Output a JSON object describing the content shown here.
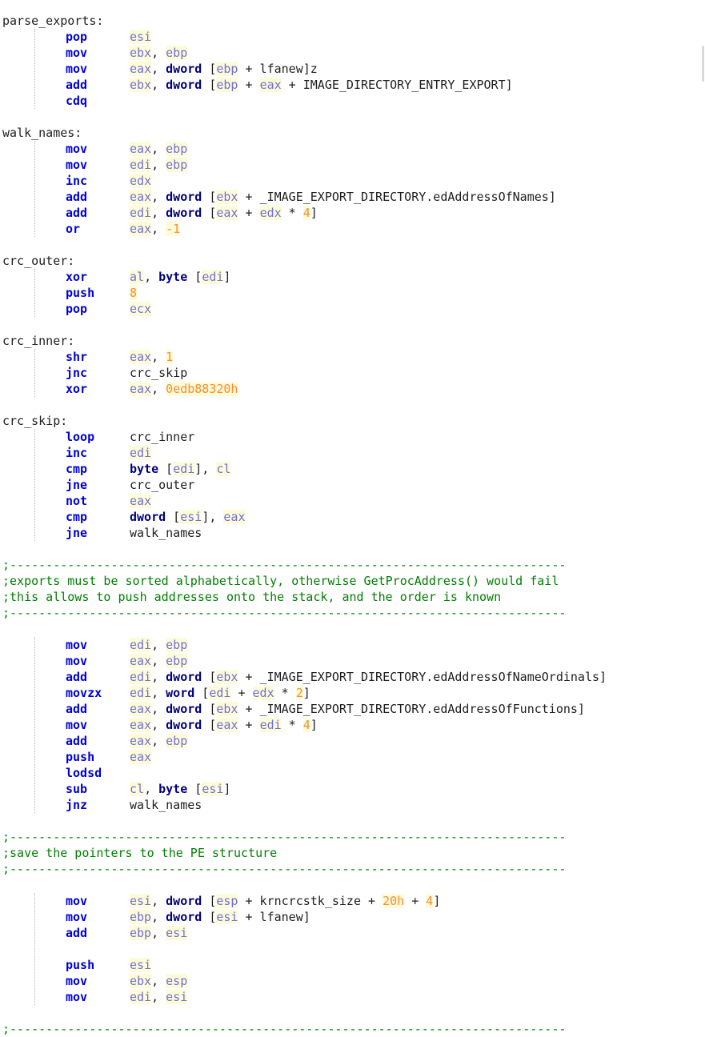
{
  "lines": [
    [
      {
        "t": "parse_exports:",
        "c": "lbl"
      }
    ],
    [
      {
        "t": "pop",
        "c": "ins"
      },
      {
        "t": "esi",
        "c": "reg"
      }
    ],
    [
      {
        "t": "mov",
        "c": "ins"
      },
      {
        "t": "ebx",
        "c": "reg"
      },
      {
        "t": ", ",
        "c": "plain"
      },
      {
        "t": "ebp",
        "c": "reg"
      }
    ],
    [
      {
        "t": "mov",
        "c": "ins"
      },
      {
        "t": "eax",
        "c": "reg"
      },
      {
        "t": ", ",
        "c": "plain"
      },
      {
        "t": "dword",
        "c": "kw"
      },
      {
        "t": " [",
        "c": "plain"
      },
      {
        "t": "ebp",
        "c": "reg"
      },
      {
        "t": " + lfanew]z",
        "c": "plain"
      }
    ],
    [
      {
        "t": "add",
        "c": "ins"
      },
      {
        "t": "ebx",
        "c": "reg"
      },
      {
        "t": ", ",
        "c": "plain"
      },
      {
        "t": "dword",
        "c": "kw"
      },
      {
        "t": " [",
        "c": "plain"
      },
      {
        "t": "ebp",
        "c": "reg"
      },
      {
        "t": " + ",
        "c": "plain"
      },
      {
        "t": "eax",
        "c": "reg"
      },
      {
        "t": " + IMAGE_DIRECTORY_ENTRY_EXPORT]",
        "c": "plain"
      }
    ],
    [
      {
        "t": "cdq",
        "c": "ins"
      }
    ],
    [],
    [
      {
        "t": "walk_names:",
        "c": "lbl"
      }
    ],
    [
      {
        "t": "mov",
        "c": "ins"
      },
      {
        "t": "eax",
        "c": "reg"
      },
      {
        "t": ", ",
        "c": "plain"
      },
      {
        "t": "ebp",
        "c": "reg"
      }
    ],
    [
      {
        "t": "mov",
        "c": "ins"
      },
      {
        "t": "edi",
        "c": "reg"
      },
      {
        "t": ", ",
        "c": "plain"
      },
      {
        "t": "ebp",
        "c": "reg"
      }
    ],
    [
      {
        "t": "inc",
        "c": "ins"
      },
      {
        "t": "edx",
        "c": "reg"
      }
    ],
    [
      {
        "t": "add",
        "c": "ins"
      },
      {
        "t": "eax",
        "c": "reg"
      },
      {
        "t": ", ",
        "c": "plain"
      },
      {
        "t": "dword",
        "c": "kw"
      },
      {
        "t": " [",
        "c": "plain"
      },
      {
        "t": "ebx",
        "c": "reg"
      },
      {
        "t": " + _IMAGE_EXPORT_DIRECTORY.edAddressOfNames]",
        "c": "plain"
      }
    ],
    [
      {
        "t": "add",
        "c": "ins"
      },
      {
        "t": "edi",
        "c": "reg"
      },
      {
        "t": ", ",
        "c": "plain"
      },
      {
        "t": "dword",
        "c": "kw"
      },
      {
        "t": " [",
        "c": "plain"
      },
      {
        "t": "eax",
        "c": "reg"
      },
      {
        "t": " + ",
        "c": "plain"
      },
      {
        "t": "edx",
        "c": "reg"
      },
      {
        "t": " * ",
        "c": "plain"
      },
      {
        "t": "4",
        "c": "num"
      },
      {
        "t": "]",
        "c": "plain"
      }
    ],
    [
      {
        "t": "or",
        "c": "ins"
      },
      {
        "t": "eax",
        "c": "reg"
      },
      {
        "t": ", ",
        "c": "plain"
      },
      {
        "t": "-1",
        "c": "num"
      }
    ],
    [],
    [
      {
        "t": "crc_outer:",
        "c": "lbl"
      }
    ],
    [
      {
        "t": "xor",
        "c": "ins"
      },
      {
        "t": "al",
        "c": "reg"
      },
      {
        "t": ", ",
        "c": "plain"
      },
      {
        "t": "byte",
        "c": "kw"
      },
      {
        "t": " [",
        "c": "plain"
      },
      {
        "t": "edi",
        "c": "reg"
      },
      {
        "t": "]",
        "c": "plain"
      }
    ],
    [
      {
        "t": "push",
        "c": "ins"
      },
      {
        "t": "8",
        "c": "num"
      }
    ],
    [
      {
        "t": "pop",
        "c": "ins"
      },
      {
        "t": "ecx",
        "c": "reg"
      }
    ],
    [],
    [
      {
        "t": "crc_inner:",
        "c": "lbl"
      }
    ],
    [
      {
        "t": "shr",
        "c": "ins"
      },
      {
        "t": "eax",
        "c": "reg"
      },
      {
        "t": ", ",
        "c": "plain"
      },
      {
        "t": "1",
        "c": "num"
      }
    ],
    [
      {
        "t": "jnc",
        "c": "ins"
      },
      {
        "t": "crc_skip",
        "c": "plain"
      }
    ],
    [
      {
        "t": "xor",
        "c": "ins"
      },
      {
        "t": "eax",
        "c": "reg"
      },
      {
        "t": ", ",
        "c": "plain"
      },
      {
        "t": "0edb88320h",
        "c": "num"
      }
    ],
    [],
    [
      {
        "t": "crc_skip:",
        "c": "lbl"
      }
    ],
    [
      {
        "t": "loop",
        "c": "ins"
      },
      {
        "t": "crc_inner",
        "c": "plain"
      }
    ],
    [
      {
        "t": "inc",
        "c": "ins"
      },
      {
        "t": "edi",
        "c": "reg"
      }
    ],
    [
      {
        "t": "cmp",
        "c": "ins"
      },
      {
        "t": "byte",
        "c": "kw"
      },
      {
        "t": " [",
        "c": "plain"
      },
      {
        "t": "edi",
        "c": "reg"
      },
      {
        "t": "], ",
        "c": "plain"
      },
      {
        "t": "cl",
        "c": "reg"
      }
    ],
    [
      {
        "t": "jne",
        "c": "ins"
      },
      {
        "t": "crc_outer",
        "c": "plain"
      }
    ],
    [
      {
        "t": "not",
        "c": "ins"
      },
      {
        "t": "eax",
        "c": "reg"
      }
    ],
    [
      {
        "t": "cmp",
        "c": "ins"
      },
      {
        "t": "dword",
        "c": "kw"
      },
      {
        "t": " [",
        "c": "plain"
      },
      {
        "t": "esi",
        "c": "reg"
      },
      {
        "t": "], ",
        "c": "plain"
      },
      {
        "t": "eax",
        "c": "reg"
      }
    ],
    [
      {
        "t": "jne",
        "c": "ins"
      },
      {
        "t": "walk_names",
        "c": "plain"
      }
    ],
    [],
    [
      {
        "t": ";-----------------------------------------------------------------------------",
        "c": "cmt"
      }
    ],
    [
      {
        "t": ";exports must be sorted alphabetically, otherwise GetProcAddress() would fail",
        "c": "cmt"
      }
    ],
    [
      {
        "t": ";this allows to push addresses onto the stack, and the order is known",
        "c": "cmt"
      }
    ],
    [
      {
        "t": ";-----------------------------------------------------------------------------",
        "c": "cmt"
      }
    ],
    [],
    [
      {
        "t": "mov",
        "c": "ins"
      },
      {
        "t": "edi",
        "c": "reg"
      },
      {
        "t": ", ",
        "c": "plain"
      },
      {
        "t": "ebp",
        "c": "reg"
      }
    ],
    [
      {
        "t": "mov",
        "c": "ins"
      },
      {
        "t": "eax",
        "c": "reg"
      },
      {
        "t": ", ",
        "c": "plain"
      },
      {
        "t": "ebp",
        "c": "reg"
      }
    ],
    [
      {
        "t": "add",
        "c": "ins"
      },
      {
        "t": "edi",
        "c": "reg"
      },
      {
        "t": ", ",
        "c": "plain"
      },
      {
        "t": "dword",
        "c": "kw"
      },
      {
        "t": " [",
        "c": "plain"
      },
      {
        "t": "ebx",
        "c": "reg"
      },
      {
        "t": " + _IMAGE_EXPORT_DIRECTORY.edAddressOfNameOrdinals]",
        "c": "plain"
      }
    ],
    [
      {
        "t": "movzx",
        "c": "ins"
      },
      {
        "t": "edi",
        "c": "reg"
      },
      {
        "t": ", ",
        "c": "plain"
      },
      {
        "t": "word",
        "c": "kw"
      },
      {
        "t": " [",
        "c": "plain"
      },
      {
        "t": "edi",
        "c": "reg"
      },
      {
        "t": " + ",
        "c": "plain"
      },
      {
        "t": "edx",
        "c": "reg"
      },
      {
        "t": " * ",
        "c": "plain"
      },
      {
        "t": "2",
        "c": "num"
      },
      {
        "t": "]",
        "c": "plain"
      }
    ],
    [
      {
        "t": "add",
        "c": "ins"
      },
      {
        "t": "eax",
        "c": "reg"
      },
      {
        "t": ", ",
        "c": "plain"
      },
      {
        "t": "dword",
        "c": "kw"
      },
      {
        "t": " [",
        "c": "plain"
      },
      {
        "t": "ebx",
        "c": "reg"
      },
      {
        "t": " + _IMAGE_EXPORT_DIRECTORY.edAddressOfFunctions]",
        "c": "plain"
      }
    ],
    [
      {
        "t": "mov",
        "c": "ins"
      },
      {
        "t": "eax",
        "c": "reg"
      },
      {
        "t": ", ",
        "c": "plain"
      },
      {
        "t": "dword",
        "c": "kw"
      },
      {
        "t": " [",
        "c": "plain"
      },
      {
        "t": "eax",
        "c": "reg"
      },
      {
        "t": " + ",
        "c": "plain"
      },
      {
        "t": "edi",
        "c": "reg"
      },
      {
        "t": " * ",
        "c": "plain"
      },
      {
        "t": "4",
        "c": "num"
      },
      {
        "t": "]",
        "c": "plain"
      }
    ],
    [
      {
        "t": "add",
        "c": "ins"
      },
      {
        "t": "eax",
        "c": "reg"
      },
      {
        "t": ", ",
        "c": "plain"
      },
      {
        "t": "ebp",
        "c": "reg"
      }
    ],
    [
      {
        "t": "push",
        "c": "ins"
      },
      {
        "t": "eax",
        "c": "reg"
      }
    ],
    [
      {
        "t": "lodsd",
        "c": "ins"
      }
    ],
    [
      {
        "t": "sub",
        "c": "ins"
      },
      {
        "t": "cl",
        "c": "reg"
      },
      {
        "t": ", ",
        "c": "plain"
      },
      {
        "t": "byte",
        "c": "kw"
      },
      {
        "t": " [",
        "c": "plain"
      },
      {
        "t": "esi",
        "c": "reg"
      },
      {
        "t": "]",
        "c": "plain"
      }
    ],
    [
      {
        "t": "jnz",
        "c": "ins"
      },
      {
        "t": "walk_names",
        "c": "plain"
      }
    ],
    [],
    [
      {
        "t": ";-----------------------------------------------------------------------------",
        "c": "cmt"
      }
    ],
    [
      {
        "t": ";save the pointers to the PE structure",
        "c": "cmt"
      }
    ],
    [
      {
        "t": ";-----------------------------------------------------------------------------",
        "c": "cmt"
      }
    ],
    [],
    [
      {
        "t": "mov",
        "c": "ins"
      },
      {
        "t": "esi",
        "c": "reg"
      },
      {
        "t": ", ",
        "c": "plain"
      },
      {
        "t": "dword",
        "c": "kw"
      },
      {
        "t": " [",
        "c": "plain"
      },
      {
        "t": "esp",
        "c": "reg"
      },
      {
        "t": " + krncrcstk_size + ",
        "c": "plain"
      },
      {
        "t": "20h",
        "c": "num"
      },
      {
        "t": " + ",
        "c": "plain"
      },
      {
        "t": "4",
        "c": "num"
      },
      {
        "t": "]",
        "c": "plain"
      }
    ],
    [
      {
        "t": "mov",
        "c": "ins"
      },
      {
        "t": "ebp",
        "c": "reg"
      },
      {
        "t": ", ",
        "c": "plain"
      },
      {
        "t": "dword",
        "c": "kw"
      },
      {
        "t": " [",
        "c": "plain"
      },
      {
        "t": "esi",
        "c": "reg"
      },
      {
        "t": " + lfanew]",
        "c": "plain"
      }
    ],
    [
      {
        "t": "add",
        "c": "ins"
      },
      {
        "t": "ebp",
        "c": "reg"
      },
      {
        "t": ", ",
        "c": "plain"
      },
      {
        "t": "esi",
        "c": "reg"
      }
    ],
    [],
    [
      {
        "t": "push",
        "c": "ins"
      },
      {
        "t": "esi",
        "c": "reg"
      }
    ],
    [
      {
        "t": "mov",
        "c": "ins"
      },
      {
        "t": "ebx",
        "c": "reg"
      },
      {
        "t": ", ",
        "c": "plain"
      },
      {
        "t": "esp",
        "c": "reg"
      }
    ],
    [
      {
        "t": "mov",
        "c": "ins"
      },
      {
        "t": "edi",
        "c": "reg"
      },
      {
        "t": ", ",
        "c": "plain"
      },
      {
        "t": "esi",
        "c": "reg"
      }
    ],
    [],
    [
      {
        "t": ";-----------------------------------------------------------------------------",
        "c": "cmt"
      }
    ]
  ]
}
